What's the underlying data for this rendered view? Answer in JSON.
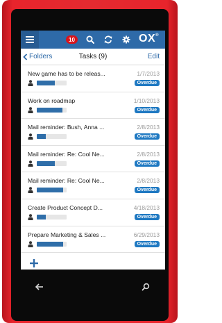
{
  "topbar": {
    "notification_count": "10",
    "logo_text": "OX",
    "logo_mark": "®"
  },
  "nav": {
    "back_label": "Folders",
    "title": "Tasks (9)",
    "edit_label": "Edit"
  },
  "tasks": [
    {
      "title": "New game has to be releas...",
      "date": "1/7/2013",
      "status": "Overdue",
      "progress": 0.6
    },
    {
      "title": "Work on roadmap",
      "date": "1/10/2013",
      "status": "Overdue",
      "progress": 0.85
    },
    {
      "title": "Mail reminder: Bush, Anna ...",
      "date": "2/8/2013",
      "status": "Overdue",
      "progress": 0.3
    },
    {
      "title": "Mail reminder: Re: Cool Ne...",
      "date": "2/8/2013",
      "status": "Overdue",
      "progress": 0.6
    },
    {
      "title": "Mail reminder: Re: Cool Ne...",
      "date": "2/8/2013",
      "status": "Overdue",
      "progress": 0.88
    },
    {
      "title": "Create Product Concept D...",
      "date": "4/18/2013",
      "status": "Overdue",
      "progress": 0.3
    },
    {
      "title": "Prepare Marketing & Sales ...",
      "date": "6/29/2013",
      "status": "Overdue",
      "progress": 0.88
    }
  ],
  "icons": {
    "menu": "menu-icon",
    "search": "search-icon",
    "refresh": "refresh-icon",
    "settings": "gear-icon",
    "back": "chevron-left-icon",
    "user": "user-icon",
    "add": "plus-icon",
    "hw_back": "back-arrow-icon",
    "hw_search": "search-icon"
  },
  "colors": {
    "phone_body": "#e42a30",
    "topbar": "#2e6aa8",
    "badge": "#d8141c",
    "overdue": "#1f79c2",
    "progress_fill": "#2f6ea9",
    "link": "#2e6aa8"
  }
}
